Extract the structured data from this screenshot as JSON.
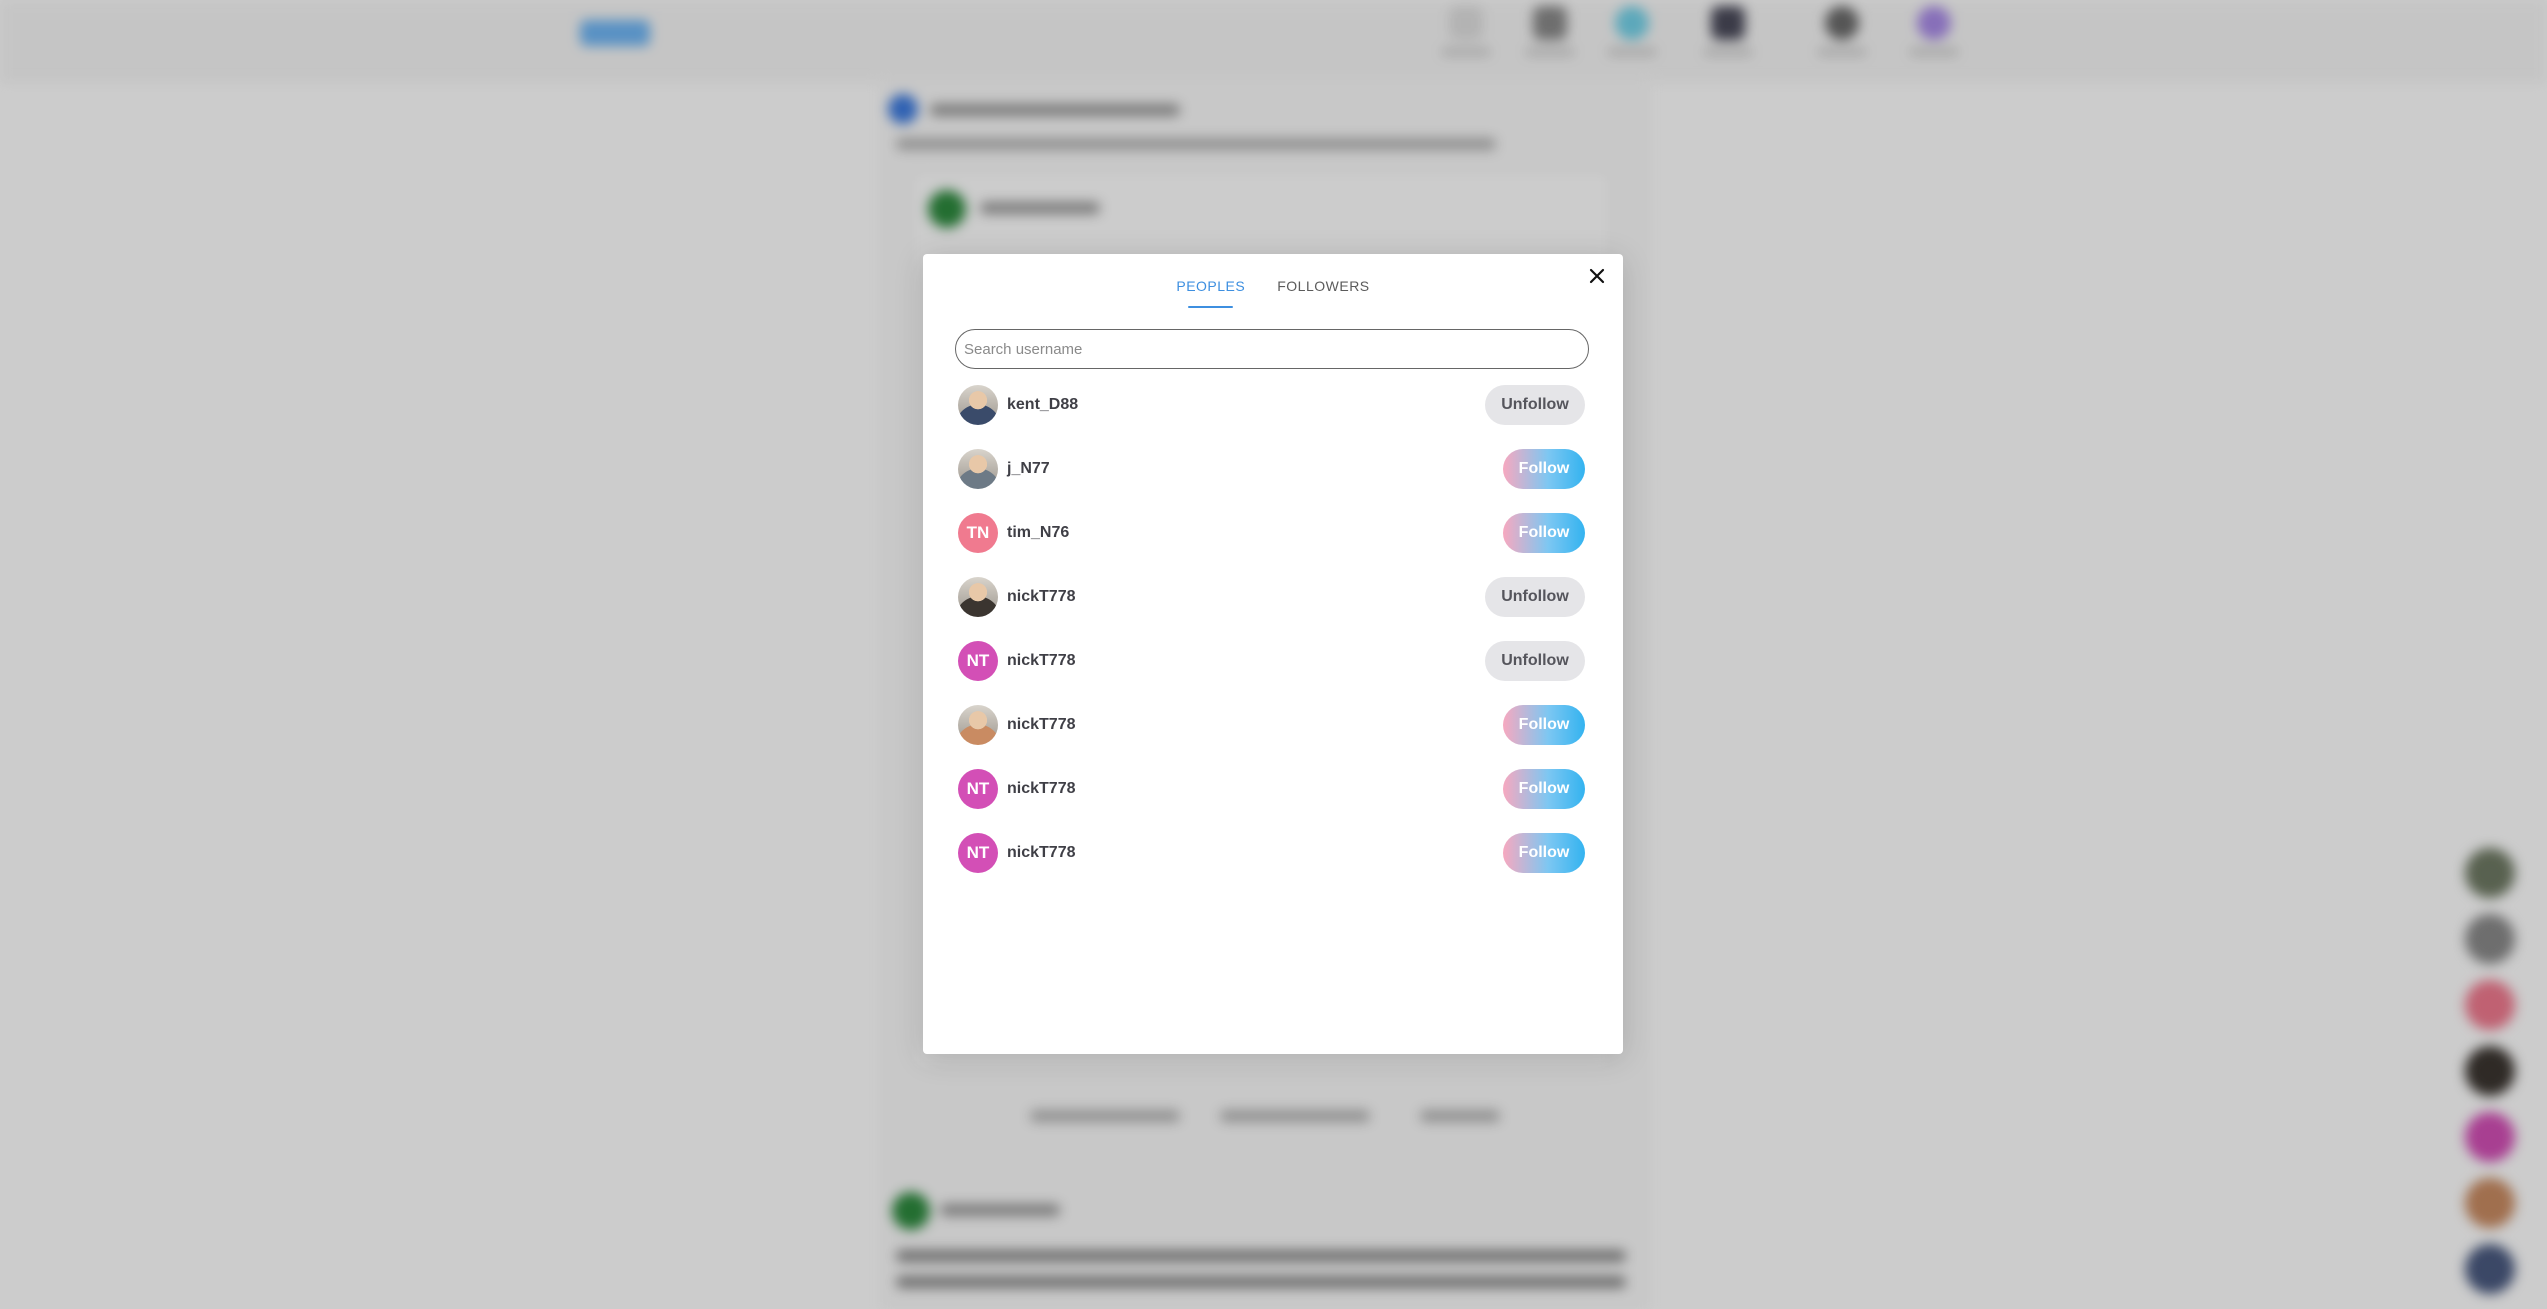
{
  "modal": {
    "tabs": [
      {
        "label": "PEOPLES",
        "active": true
      },
      {
        "label": "FOLLOWERS",
        "active": false
      }
    ],
    "close_icon": "close-icon",
    "search": {
      "placeholder": "Search username",
      "value": ""
    },
    "users": [
      {
        "username": "kent_D88",
        "avatar_type": "photo",
        "avatar_initials": "",
        "avatar_color": "#3a4b6a",
        "action": "Unfollow"
      },
      {
        "username": "j_N77",
        "avatar_type": "photo",
        "avatar_initials": "",
        "avatar_color": "#6d7a86",
        "action": "Follow"
      },
      {
        "username": "tim_N76",
        "avatar_type": "initials",
        "avatar_initials": "TN",
        "avatar_color": "#f07a8f",
        "action": "Follow"
      },
      {
        "username": "nickT778",
        "avatar_type": "photo",
        "avatar_initials": "",
        "avatar_color": "#3b3530",
        "action": "Unfollow"
      },
      {
        "username": "nickT778",
        "avatar_type": "initials",
        "avatar_initials": "NT",
        "avatar_color": "#d34fb6",
        "action": "Unfollow"
      },
      {
        "username": "nickT778",
        "avatar_type": "photo",
        "avatar_initials": "",
        "avatar_color": "#c98b62",
        "action": "Follow"
      },
      {
        "username": "nickT778",
        "avatar_type": "initials",
        "avatar_initials": "NT",
        "avatar_color": "#d34fb6",
        "action": "Follow"
      },
      {
        "username": "nickT778",
        "avatar_type": "initials",
        "avatar_initials": "NT",
        "avatar_color": "#d34fb6",
        "action": "Follow"
      }
    ]
  },
  "colors": {
    "accent": "#3d8fe0",
    "follow_gradient_start": "#f7a8bf",
    "follow_gradient_end": "#33b3f0",
    "unfollow_bg": "#e5e5e8",
    "overlay": "rgba(0,0,0,0.2)"
  }
}
